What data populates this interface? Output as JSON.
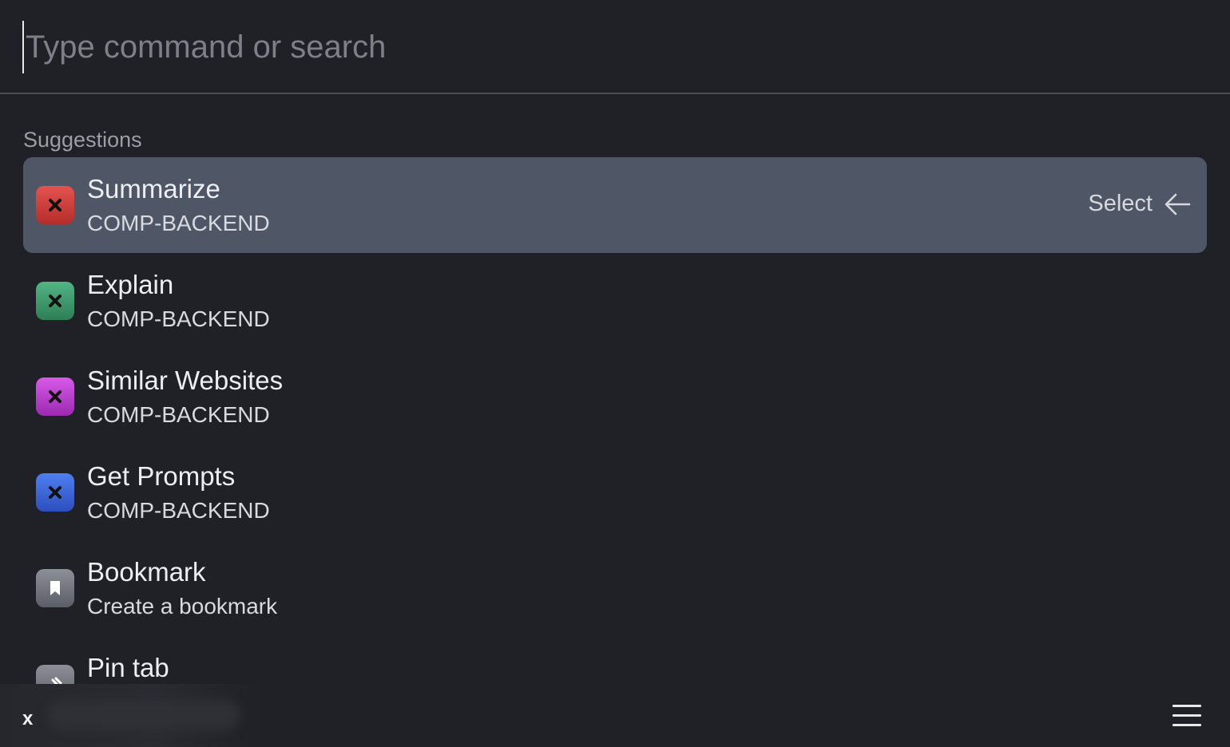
{
  "search": {
    "placeholder": "Type command or search",
    "value": ""
  },
  "suggestions": {
    "label": "Suggestions",
    "items": [
      {
        "title": "Summarize",
        "subtitle": "COMP-BACKEND",
        "icon": "close-icon",
        "color": "#d9413e",
        "selected": true,
        "action_label": "Select"
      },
      {
        "title": "Explain",
        "subtitle": "COMP-BACKEND",
        "icon": "close-icon",
        "color": "#3f9b6c",
        "selected": false
      },
      {
        "title": "Similar Websites",
        "subtitle": "COMP-BACKEND",
        "icon": "close-icon",
        "color": "#bc44d0",
        "selected": false
      },
      {
        "title": "Get Prompts",
        "subtitle": "COMP-BACKEND",
        "icon": "close-icon",
        "color": "#3e66d8",
        "selected": false
      },
      {
        "title": "Bookmark",
        "subtitle": "Create a bookmark",
        "icon": "bookmark-icon",
        "color": "#757780",
        "selected": false
      },
      {
        "title": "Pin tab",
        "subtitle": "",
        "icon": "pin-icon",
        "color": "#757780",
        "selected": false
      }
    ]
  },
  "footer": {
    "close_label": "x",
    "menu_icon": "hamburger-menu-icon"
  }
}
